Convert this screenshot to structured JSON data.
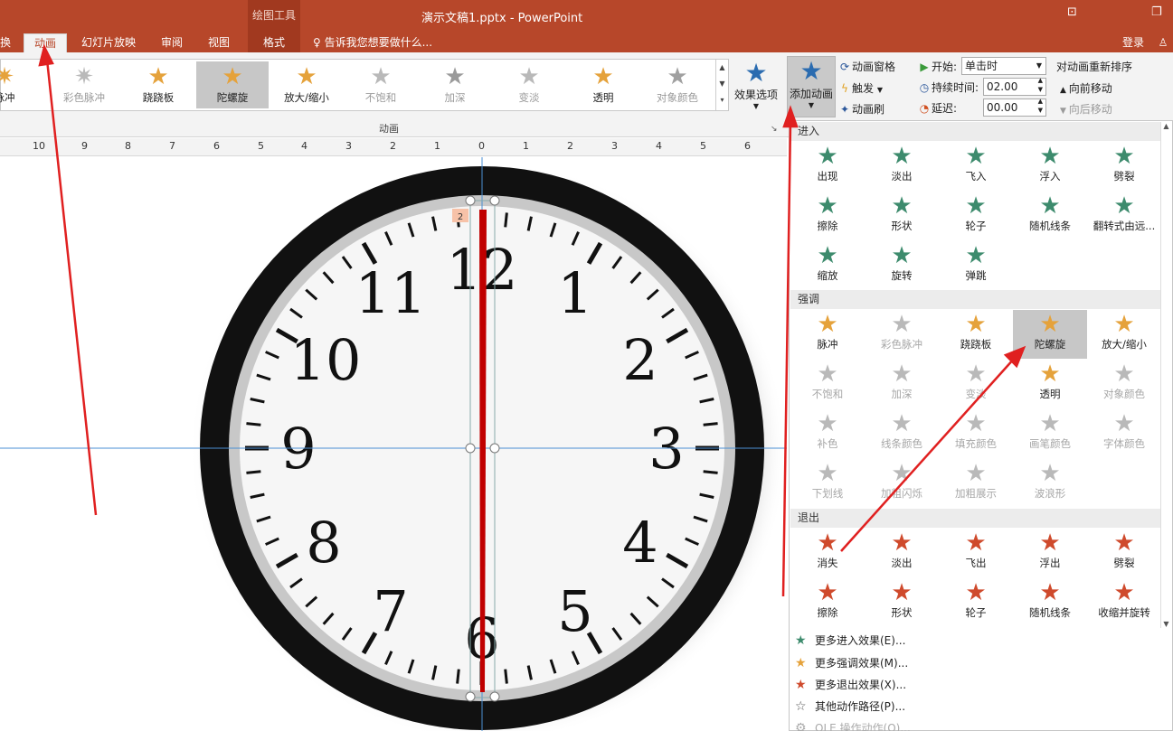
{
  "titlebar": {
    "document_title": "演示文稿1.pptx - PowerPoint",
    "context_tool": "绘图工具",
    "ribbon_display_icon": "ribbon-display-icon",
    "restore_icon": "restore-icon"
  },
  "tabs": [
    {
      "label": "换",
      "active": false
    },
    {
      "label": "动画",
      "active": true
    },
    {
      "label": "幻灯片放映",
      "active": false
    },
    {
      "label": "审阅",
      "active": false
    },
    {
      "label": "视图",
      "active": false
    },
    {
      "label": "格式",
      "active": false
    }
  ],
  "tellme": "告诉我您想要做什么...",
  "login": "登录",
  "gallery": [
    {
      "label": "脉冲",
      "color": "#e8a33b",
      "dim": false
    },
    {
      "label": "彩色脉冲",
      "color": "#c9c9c9",
      "dim": true
    },
    {
      "label": "跷跷板",
      "color": "#e8a33b",
      "dim": false
    },
    {
      "label": "陀螺旋",
      "color": "#e8a33b",
      "dim": false,
      "selected": true
    },
    {
      "label": "放大/缩小",
      "color": "#e8a33b",
      "dim": false
    },
    {
      "label": "不饱和",
      "color": "#b5b5b5",
      "dim": true
    },
    {
      "label": "加深",
      "color": "#9a9a9a",
      "dim": true
    },
    {
      "label": "变淡",
      "color": "#cfcfcf",
      "dim": true
    },
    {
      "label": "透明",
      "color": "#e8a33b",
      "dim": false
    },
    {
      "label": "对象颜色",
      "color": "#a0a0a0",
      "dim": true
    }
  ],
  "group_animation_label": "动画",
  "effect_options": "效果选项",
  "add_animation": "添加动画",
  "advanced": {
    "pane": "动画窗格",
    "trigger": "触发",
    "painter": "动画刷"
  },
  "timing": {
    "start_label": "开始:",
    "start_value": "单击时",
    "duration_label": "持续时间:",
    "duration_value": "02.00",
    "delay_label": "延迟:",
    "delay_value": "00.00"
  },
  "reorder": {
    "title": "对动画重新排序",
    "forward": "向前移动",
    "backward": "向后移动"
  },
  "ruler_labels": [
    "10",
    "9",
    "8",
    "7",
    "6",
    "5",
    "4",
    "3",
    "2",
    "1",
    "0",
    "1",
    "2",
    "3",
    "4",
    "5",
    "6"
  ],
  "clock": {
    "numbers": [
      "12",
      "1",
      "2",
      "3",
      "4",
      "5",
      "6",
      "7",
      "8",
      "9",
      "10",
      "11"
    ],
    "animation_tag": "2",
    "hand_color": "#c00000"
  },
  "dropdown": {
    "sections": {
      "enter": "进入",
      "emphasis": "强调",
      "exit": "退出"
    },
    "enter_items": [
      "出现",
      "淡出",
      "飞入",
      "浮入",
      "劈裂",
      "擦除",
      "形状",
      "轮子",
      "随机线条",
      "翻转式由远...",
      "缩放",
      "旋转",
      "弹跳"
    ],
    "emphasis_items": [
      {
        "label": "脉冲",
        "dim": false
      },
      {
        "label": "彩色脉冲",
        "dim": true
      },
      {
        "label": "跷跷板",
        "dim": false
      },
      {
        "label": "陀螺旋",
        "dim": false,
        "selected": true
      },
      {
        "label": "放大/缩小",
        "dim": false
      },
      {
        "label": "不饱和",
        "dim": true
      },
      {
        "label": "加深",
        "dim": true
      },
      {
        "label": "变淡",
        "dim": true
      },
      {
        "label": "透明",
        "dim": false
      },
      {
        "label": "对象颜色",
        "dim": true
      },
      {
        "label": "补色",
        "dim": true
      },
      {
        "label": "线条颜色",
        "dim": true
      },
      {
        "label": "填充颜色",
        "dim": true
      },
      {
        "label": "画笔颜色",
        "dim": true
      },
      {
        "label": "字体颜色",
        "dim": true
      },
      {
        "label": "下划线",
        "dim": true
      },
      {
        "label": "加粗闪烁",
        "dim": true
      },
      {
        "label": "加粗展示",
        "dim": true
      },
      {
        "label": "波浪形",
        "dim": true
      }
    ],
    "exit_items": [
      "消失",
      "淡出",
      "飞出",
      "浮出",
      "劈裂",
      "擦除",
      "形状",
      "轮子",
      "随机线条",
      "收缩并旋转"
    ],
    "more": [
      {
        "label": "更多进入效果(E)...",
        "icon": "green-star-icon"
      },
      {
        "label": "更多强调效果(M)...",
        "icon": "gold-star-icon"
      },
      {
        "label": "更多退出效果(X)...",
        "icon": "red-star-icon"
      },
      {
        "label": "其他动作路径(P)...",
        "icon": "outline-star-icon"
      },
      {
        "label": "OLE 操作动作(O)...",
        "icon": "gear-icon"
      }
    ]
  },
  "colors": {
    "accent": "#b7472a",
    "enter": "#3d8b6d",
    "emphasis": "#e5a23b",
    "exit": "#cf4a2c",
    "arrow": "#e02020"
  }
}
